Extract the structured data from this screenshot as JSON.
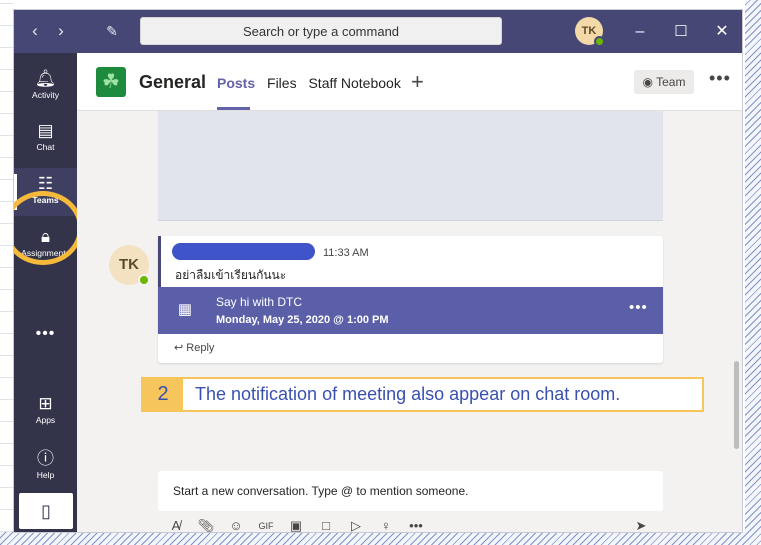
{
  "search": {
    "placeholder": "Search or type a command"
  },
  "user": {
    "initials": "TK"
  },
  "rail": {
    "items": [
      {
        "label": "Activity",
        "icon": "bell-icon"
      },
      {
        "label": "Chat",
        "icon": "chat-icon"
      },
      {
        "label": "Teams",
        "icon": "teams-icon"
      },
      {
        "label": "Assignments",
        "icon": "assignments-icon"
      },
      {
        "label": "Apps",
        "icon": "apps-icon"
      },
      {
        "label": "Help",
        "icon": "help-icon"
      }
    ]
  },
  "channel": {
    "name": "General",
    "tabs": [
      "Posts",
      "Files",
      "Staff Notebook"
    ],
    "team_button": "Team"
  },
  "post": {
    "author_initials": "TK",
    "time": "11:33 AM",
    "text": "อย่าลืมเข้าเรียนกันนะ",
    "meeting_title": "Say hi with DTC",
    "meeting_time": "Monday, May 25, 2020 @ 1:00 PM",
    "reply": "Reply"
  },
  "annotation": {
    "number": "2",
    "text": "The notification of meeting also appear on chat room."
  },
  "compose": {
    "placeholder": "Start a new conversation. Type @ to mention someone."
  },
  "colors": {
    "titlebar": "#464775",
    "rail": "#33344a",
    "accent": "#6264a7",
    "meeting": "#5b5fa8",
    "annotation": "#f6c55b"
  }
}
